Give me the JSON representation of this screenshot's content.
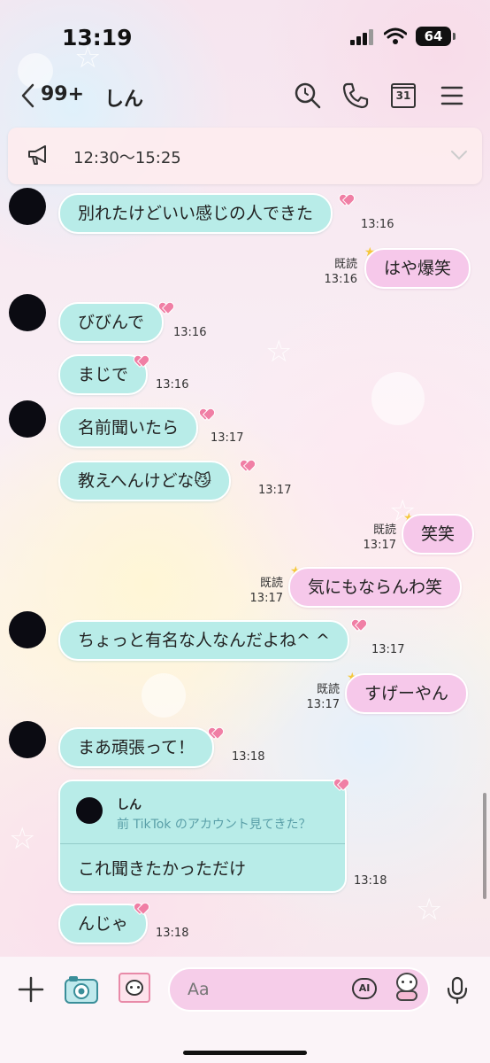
{
  "status_bar": {
    "time": "13:19",
    "battery": "64"
  },
  "header": {
    "unread_count": "99+",
    "chat_name": "しん"
  },
  "announcement": {
    "text": "12:30〜15:25"
  },
  "messages": [
    {
      "text": "別れたけどいい感じの人できた",
      "time": "13:16"
    },
    {
      "text": "はや爆笑",
      "read": "既読",
      "time": "13:16"
    },
    {
      "text": "びびんで",
      "time": "13:16"
    },
    {
      "text": "まじで",
      "time": "13:16"
    },
    {
      "text": "名前聞いたら",
      "time": "13:17"
    },
    {
      "text": "教えへんけどな😼",
      "time": "13:17"
    },
    {
      "text": "笑笑",
      "read": "既読",
      "time": "13:17"
    },
    {
      "text": "気にもならんわ笑",
      "read": "既読",
      "time": "13:17"
    },
    {
      "text": "ちょっと有名な人なんだよね^ ^",
      "time": "13:17"
    },
    {
      "text": "すげーやん",
      "read": "既読",
      "time": "13:17"
    },
    {
      "text": "まあ頑張って！",
      "time": "13:18"
    },
    {
      "reply_name": "しん",
      "reply_quote": "前 TikTok のアカウント見てきた？",
      "text": "これ聞きたかっただけ",
      "time": "13:18"
    },
    {
      "text": "んじゃ",
      "time": "13:18"
    }
  ],
  "input": {
    "placeholder": "Aa",
    "ai_label": "AI"
  },
  "icons": [
    "back-icon",
    "search-icon",
    "phone-icon",
    "calendar-icon",
    "menu-icon",
    "megaphone-icon",
    "chevron-down-icon",
    "plus-icon",
    "camera-icon",
    "gallery-icon",
    "ai-icon",
    "sticker-icon",
    "mic-icon"
  ],
  "calendar_day": "31",
  "colors": {
    "incoming_bubble": "#b8ece8",
    "outgoing_bubble": "#f6c8ea",
    "heart": "#f07fa5"
  }
}
